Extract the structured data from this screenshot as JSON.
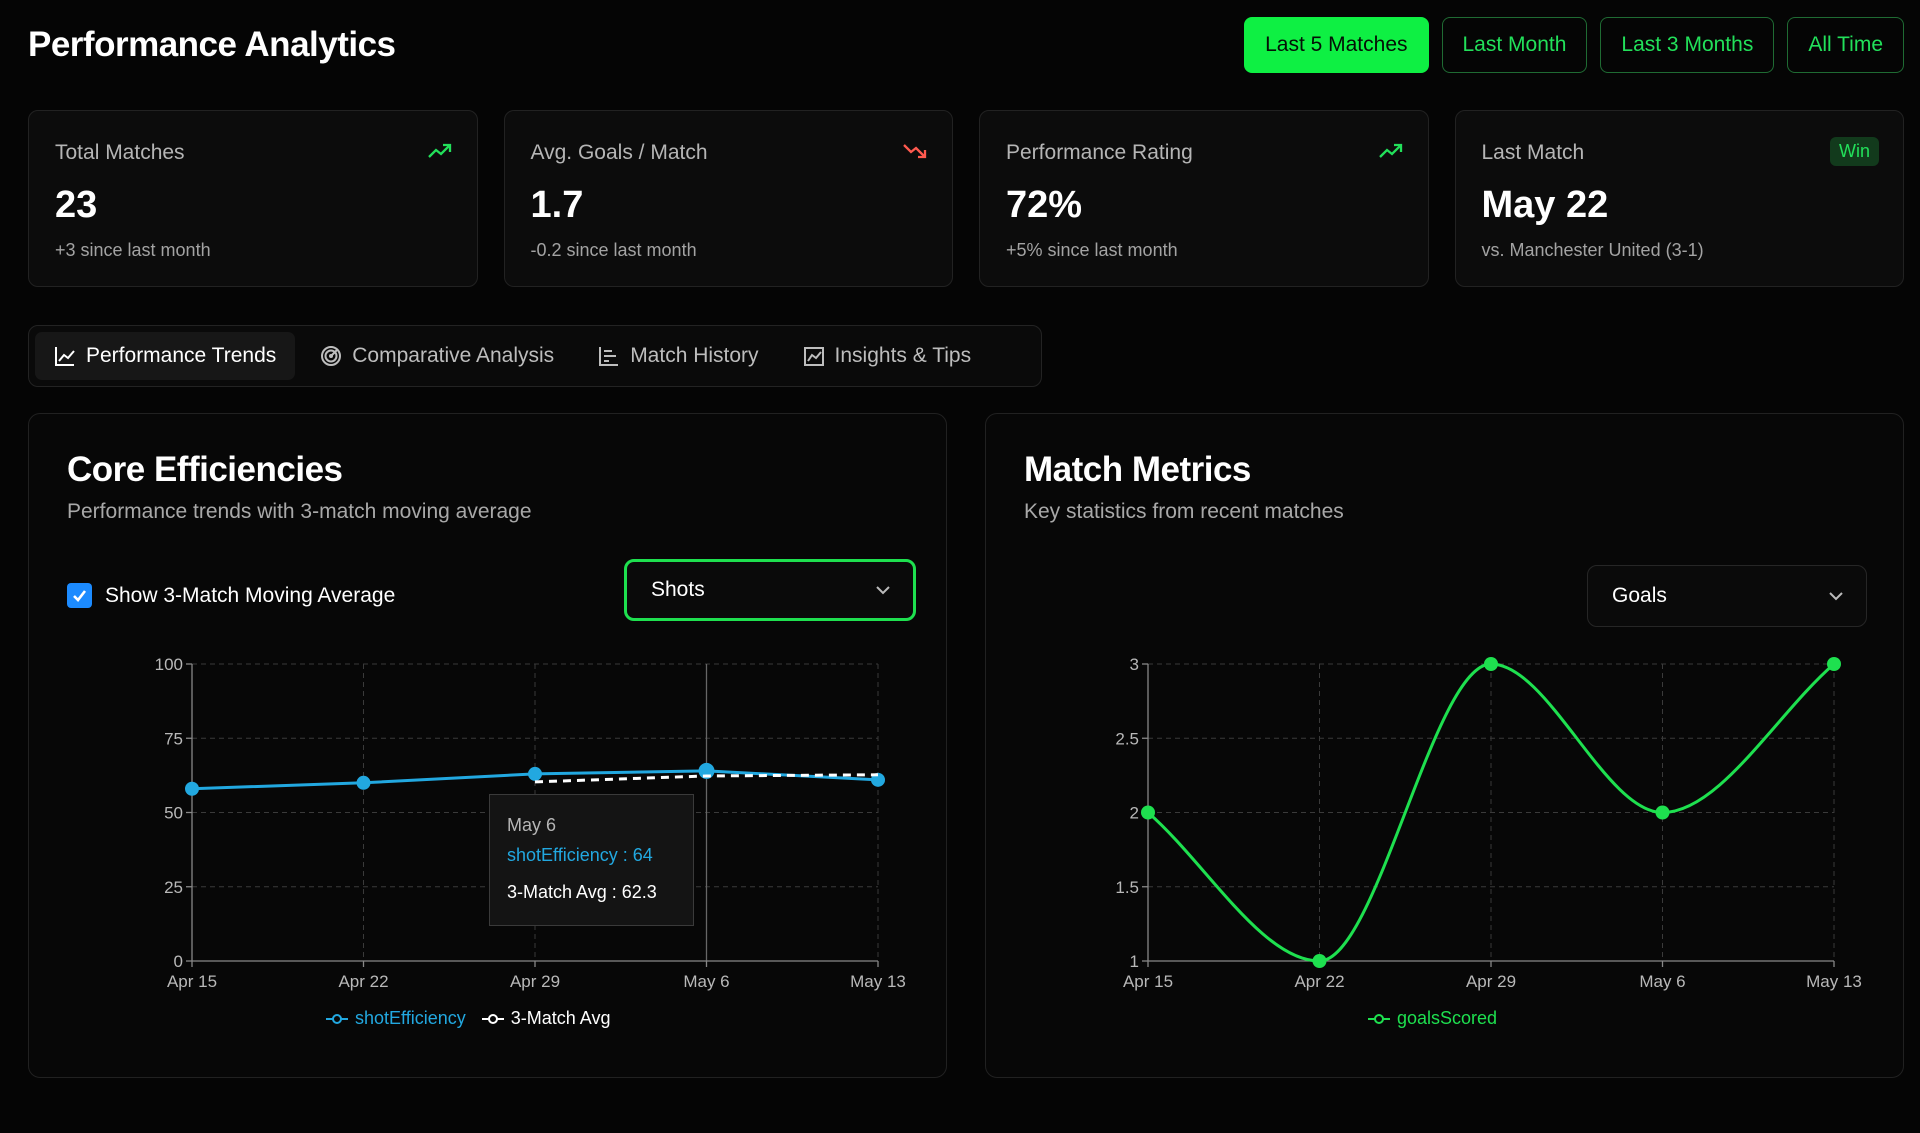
{
  "header": {
    "title": "Performance Analytics",
    "ranges": [
      "Last 5 Matches",
      "Last Month",
      "Last 3 Months",
      "All Time"
    ],
    "active_range": "Last 5 Matches"
  },
  "cards": [
    {
      "label": "Total Matches",
      "value": "23",
      "sub": "+3 since last month",
      "trend": "up"
    },
    {
      "label": "Avg. Goals / Match",
      "value": "1.7",
      "sub": "-0.2 since last month",
      "trend": "down"
    },
    {
      "label": "Performance Rating",
      "value": "72%",
      "sub": "+5% since last month",
      "trend": "up"
    },
    {
      "label": "Last Match",
      "value": "May 22",
      "sub": "vs. Manchester United (3-1)",
      "badge": "Win"
    }
  ],
  "tabs": [
    {
      "label": "Performance Trends",
      "icon": "line-chart-icon",
      "active": true
    },
    {
      "label": "Comparative Analysis",
      "icon": "radar-icon"
    },
    {
      "label": "Match History",
      "icon": "bar-chart-icon"
    },
    {
      "label": "Insights & Tips",
      "icon": "area-chart-icon"
    }
  ],
  "core": {
    "title": "Core Efficiencies",
    "subtitle": "Performance trends with 3-match moving average",
    "toggle_label": "Show 3-Match Moving Average",
    "toggle_checked": true,
    "metric_select": "Shots",
    "tooltip": {
      "date": "May 6",
      "line1": "shotEfficiency : 64",
      "line2": "3-Match Avg : 62.3"
    }
  },
  "metrics": {
    "title": "Match Metrics",
    "subtitle": "Key statistics from recent matches",
    "metric_select": "Goals"
  },
  "colors": {
    "accent": "#0ef043",
    "series_blue": "#22a8e0",
    "series_green": "#1ee04f",
    "down": "#ff5a4f"
  },
  "chart_data": [
    {
      "type": "line",
      "x": [
        "Apr 15",
        "Apr 22",
        "Apr 29",
        "May 6",
        "May 13"
      ],
      "ylim": [
        0,
        100
      ],
      "yticks": [
        0,
        25,
        50,
        75,
        100
      ],
      "grid": true,
      "series": [
        {
          "name": "shotEfficiency",
          "values": [
            58,
            60,
            63,
            64,
            61
          ]
        },
        {
          "name": "3-Match Avg",
          "values": [
            null,
            null,
            60.3,
            62.3,
            62.7
          ],
          "dashed": true
        }
      ],
      "legend": "bottom"
    },
    {
      "type": "line",
      "x": [
        "Apr 15",
        "Apr 22",
        "Apr 29",
        "May 6",
        "May 13"
      ],
      "ylim": [
        1,
        3
      ],
      "yticks": [
        1,
        1.5,
        2,
        2.5,
        3
      ],
      "grid": true,
      "series": [
        {
          "name": "goalsScored",
          "values": [
            2,
            1,
            3,
            2,
            3
          ]
        }
      ],
      "legend": "bottom"
    }
  ]
}
